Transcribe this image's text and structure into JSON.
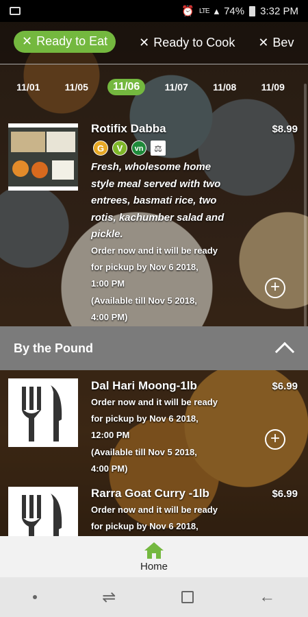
{
  "status_bar": {
    "battery": "74%",
    "time": "3:32 PM",
    "network": "LTE"
  },
  "tabs": [
    {
      "label": "Ready to Eat",
      "active": true
    },
    {
      "label": "Ready to Cook",
      "active": false
    },
    {
      "label": "Bev",
      "active": false
    }
  ],
  "dates": [
    "11/01",
    "11/05",
    "11/06",
    "11/07",
    "11/08",
    "11/09"
  ],
  "selected_date": "11/06",
  "item1": {
    "title": "Rotifix Dabba",
    "price": "$8.99",
    "badges": [
      "G",
      "V",
      "vn",
      "⚖"
    ],
    "description": "Fresh, wholesome home style meal served with two entrees, basmati rice, two rotis, kachumber salad and pickle.",
    "order_lines": [
      "Order now and it will be ready",
      "for pickup by  Nov 6 2018,",
      "1:00 PM",
      "(Available till  Nov 5 2018,",
      "4:00 PM)"
    ]
  },
  "section": {
    "title": "By the Pound"
  },
  "item2": {
    "title": "Dal Hari Moong-1lb",
    "price": "$6.99",
    "order_lines": [
      "Order now and it will be ready",
      "for pickup by  Nov 6 2018,",
      "12:00 PM",
      "(Available till Nov 5 2018,",
      "4:00 PM)"
    ]
  },
  "item3": {
    "title": "Rarra Goat Curry  -1lb",
    "price": "$6.99",
    "order_lines": [
      "Order now and it will be ready",
      "for pickup by  Nov 6 2018,"
    ]
  },
  "bottom_nav": {
    "home_label": "Home"
  },
  "colors": {
    "accent": "#74b83f",
    "section_bar": "#7b7b7b"
  }
}
